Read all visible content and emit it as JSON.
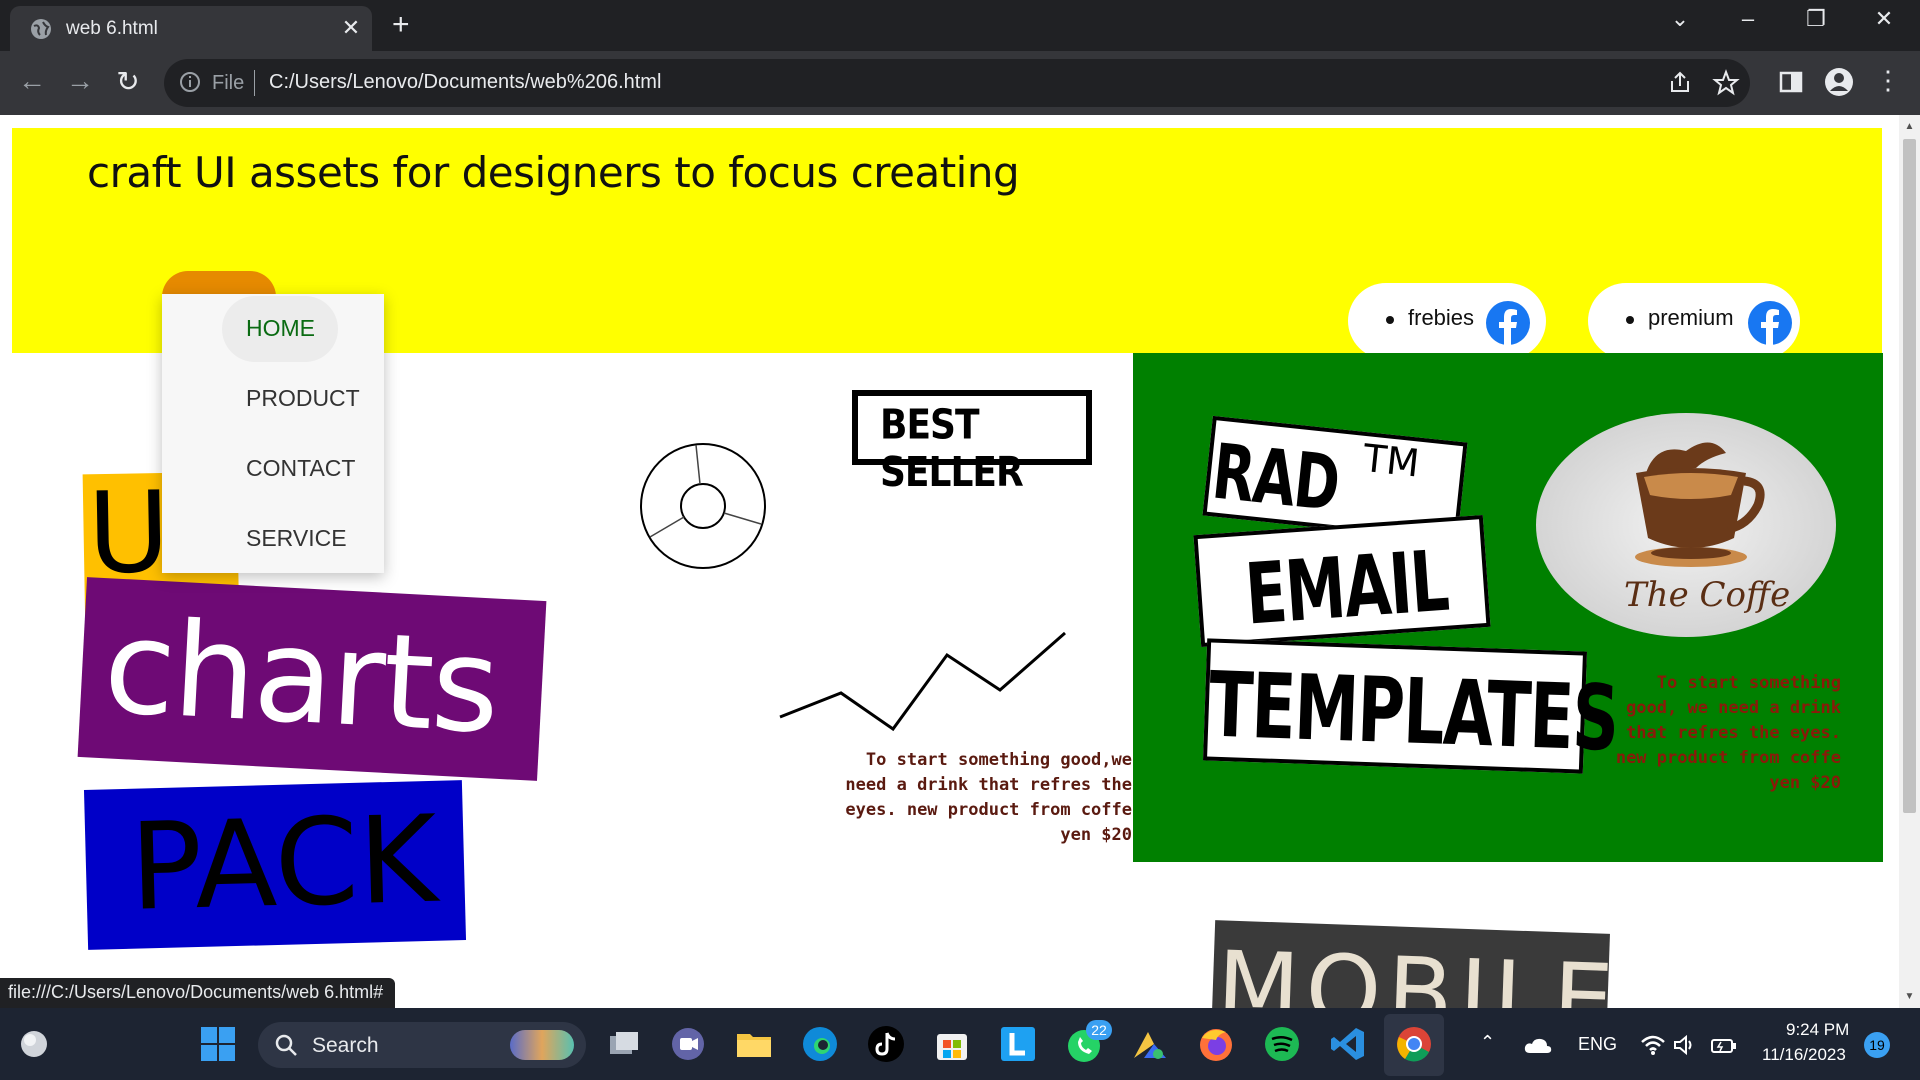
{
  "browser": {
    "tab_title": "web 6.html",
    "omnibox_scheme": "File",
    "url": "C:/Users/Lenovo/Documents/web%206.html",
    "status_url": "file:///C:/Users/Lenovo/Documents/web 6.html#"
  },
  "page": {
    "tagline": "craft UI assets for designers to focus creating",
    "menu": [
      {
        "label": "HOME",
        "active": true
      },
      {
        "label": "PRODUCT",
        "active": false
      },
      {
        "label": "CONTACT",
        "active": false
      },
      {
        "label": "SERVICE",
        "active": false
      }
    ],
    "pills": [
      {
        "label": "frebies",
        "icon": "facebook-icon"
      },
      {
        "label": "premium",
        "icon": "facebook-icon"
      }
    ],
    "hero": {
      "word1": "UI",
      "word2": "charts",
      "word3": "PACK"
    },
    "badge": "BEST SELLER",
    "product_desc": "To start something good,we need a drink that refres the eyes. new product from coffe yen $20",
    "rad": {
      "line1": "RAD",
      "tm": "TM",
      "line2": "EMAIL",
      "line3": "TEMPLATES"
    },
    "coffee_logo": "The Coffe",
    "coffee_desc": "To start something good, we need a drink that refres the eyes. new product from coffe yen $20",
    "mobile": "MOBILE",
    "colors": {
      "header": "#ffff00",
      "green_panel": "#008000",
      "charts_box": "#6e0a75",
      "pack_box": "#0000c8",
      "ui_box": "#ffc000"
    }
  },
  "taskbar": {
    "search_label": "Search",
    "whatsapp_badge": "22",
    "lang": "ENG",
    "time": "9:24 PM",
    "date": "11/16/2023",
    "notifications": "19"
  }
}
